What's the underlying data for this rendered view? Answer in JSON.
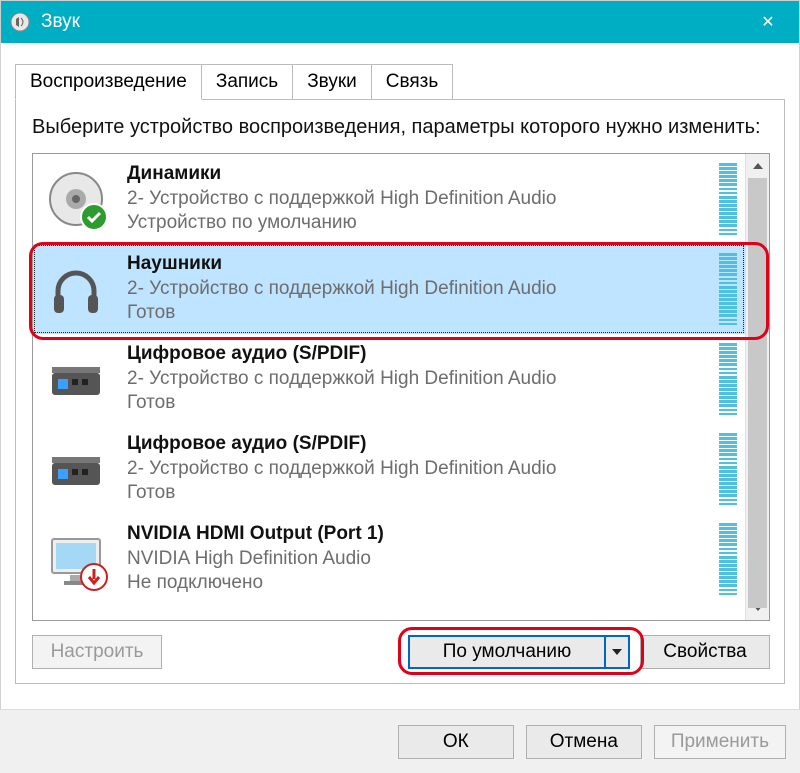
{
  "window": {
    "title": "Звук",
    "close_label": "✕"
  },
  "tabs": {
    "playback": "Воспроизведение",
    "recording": "Запись",
    "sounds": "Звуки",
    "communications": "Связь"
  },
  "instruction": "Выберите устройство воспроизведения, параметры которого нужно изменить:",
  "devices": [
    {
      "name": "Динамики",
      "desc": "2- Устройство с поддержкой High Definition Audio",
      "status": "Устройство по умолчанию",
      "icon": "speaker",
      "badge": "check",
      "selected": false
    },
    {
      "name": "Наушники",
      "desc": "2- Устройство с поддержкой High Definition Audio",
      "status": "Готов",
      "icon": "headphones",
      "badge": null,
      "selected": true
    },
    {
      "name": "Цифровое аудио (S/PDIF)",
      "desc": "2- Устройство с поддержкой High Definition Audio",
      "status": "Готов",
      "icon": "spdif",
      "badge": null,
      "selected": false
    },
    {
      "name": "Цифровое аудио (S/PDIF)",
      "desc": "2- Устройство с поддержкой High Definition Audio",
      "status": "Готов",
      "icon": "spdif",
      "badge": null,
      "selected": false
    },
    {
      "name": "NVIDIA HDMI Output (Port 1)",
      "desc": "NVIDIA High Definition Audio",
      "status": "Не подключено",
      "icon": "monitor",
      "badge": "down",
      "selected": false
    }
  ],
  "buttons": {
    "configure": "Настроить",
    "default": "По умолчанию",
    "properties": "Свойства",
    "ok": "ОК",
    "cancel": "Отмена",
    "apply": "Применить"
  }
}
